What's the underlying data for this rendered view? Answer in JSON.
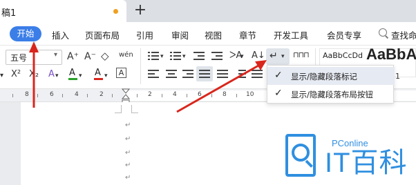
{
  "document_tab": {
    "title": "稿1",
    "new_tab_symbol": "+",
    "unsaved_dot_color": "#f0a020"
  },
  "menu": {
    "active": "开始",
    "items": [
      "插入",
      "页面布局",
      "引用",
      "审阅",
      "视图",
      "章节",
      "开发工具",
      "会员专享"
    ],
    "search_label": "查找命",
    "accent_color": "#3b7ee8"
  },
  "ribbon": {
    "font_size": "五号",
    "style_preview_small": "AaBbCcDd",
    "style_preview_large": "AaBbA",
    "font_grow": "A⁺",
    "font_shrink": "A⁻",
    "clear_format": "◇",
    "phonetic": "wén",
    "superscript": "X²",
    "subscript": "X₂",
    "text_effect": "A",
    "highlight": "A",
    "font_color": "A",
    "char_border": "A",
    "style_sort": "A↓",
    "line_spacing_value": "1"
  },
  "dropdown": {
    "items": [
      {
        "label": "显示/隐藏段落标记",
        "checked": true
      },
      {
        "label": "显示/隐藏段落布局按钮",
        "checked": true
      }
    ]
  },
  "ruler": {
    "numbers": [
      "8",
      "6",
      "4",
      "2",
      "2",
      "4",
      "6",
      "8",
      "10"
    ]
  },
  "paragraph_mark": "↵",
  "watermark": {
    "brand_small": "PConline",
    "brand_large": "IT百科",
    "color": "#2f8fe0"
  },
  "annotation_color": "#d9261c"
}
